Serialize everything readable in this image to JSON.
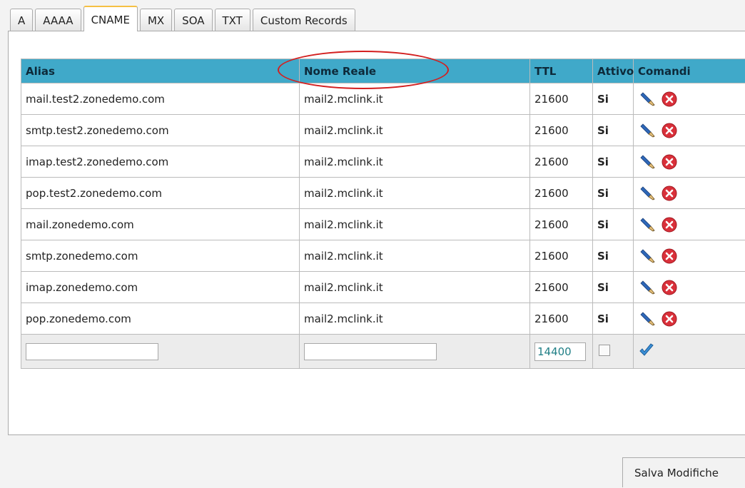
{
  "tabs": [
    "A",
    "AAAA",
    "CNAME",
    "MX",
    "SOA",
    "TXT",
    "Custom Records"
  ],
  "active_tab": "CNAME",
  "table": {
    "headers": {
      "alias": "Alias",
      "real_name": "Nome Reale",
      "ttl": "TTL",
      "active": "Attivo",
      "commands": "Comandi"
    },
    "rows": [
      {
        "alias": "mail.test2.zonedemo.com",
        "real_name": "mail2.mclink.it",
        "ttl": "21600",
        "active": "Si"
      },
      {
        "alias": "smtp.test2.zonedemo.com",
        "real_name": "mail2.mclink.it",
        "ttl": "21600",
        "active": "Si"
      },
      {
        "alias": "imap.test2.zonedemo.com",
        "real_name": "mail2.mclink.it",
        "ttl": "21600",
        "active": "Si"
      },
      {
        "alias": "pop.test2.zonedemo.com",
        "real_name": "mail2.mclink.it",
        "ttl": "21600",
        "active": "Si"
      },
      {
        "alias": "mail.zonedemo.com",
        "real_name": "mail2.mclink.it",
        "ttl": "21600",
        "active": "Si"
      },
      {
        "alias": "smtp.zonedemo.com",
        "real_name": "mail2.mclink.it",
        "ttl": "21600",
        "active": "Si"
      },
      {
        "alias": "imap.zonedemo.com",
        "real_name": "mail2.mclink.it",
        "ttl": "21600",
        "active": "Si"
      },
      {
        "alias": "pop.zonedemo.com",
        "real_name": "mail2.mclink.it",
        "ttl": "21600",
        "active": "Si"
      }
    ],
    "new_row": {
      "alias_value": "",
      "real_name_value": "",
      "ttl_value": "14400",
      "active_checked": false
    }
  },
  "icons": {
    "edit": "pencil-icon",
    "delete": "delete-icon",
    "confirm": "checkmark-icon"
  },
  "colors": {
    "header_bg": "#40a9c9",
    "active_text": "#2f8a22",
    "delete_red": "#d9303a",
    "annotation": "#d31f1f"
  },
  "save_label": "Salva Modifiche"
}
